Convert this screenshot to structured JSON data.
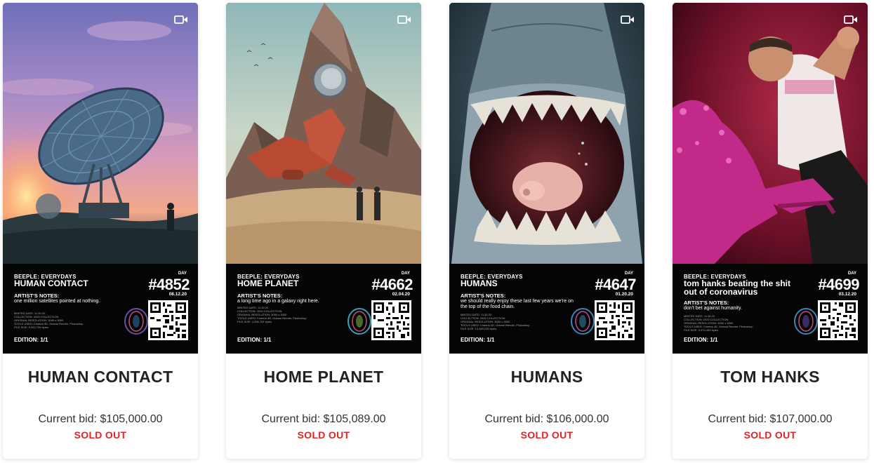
{
  "colors": {
    "sold_out": "#e02424",
    "card_bg": "#ffffff",
    "panel_bg": "#050505"
  },
  "icons": {
    "card_badge": "video-camera-icon"
  },
  "cards": [
    {
      "title": "HUMAN CONTACT",
      "bid_text": "Current bid: $105,000.00",
      "status": "SOLD OUT",
      "panel": {
        "series": "BEEPLE: EVERYDAYS",
        "art_title": "HUMAN CONTACT",
        "notes_heading": "ARTIST'S NOTES:",
        "notes": "one million satellites pointed at nothing.",
        "meta": "MINTED DATE: 11.30.20\nCOLLECTION: 2020 COLLECTION\nORIGINAL RESOLUTION: 3000 x 3000\nTOOLS USED: Cinema 4D, Octane Render, Photoshop\nFILE SIZE: 5,052,739 bytes",
        "day_label": "DAY",
        "day_number": "#4852",
        "date": "08.12.20",
        "edition": "EDITION: 1/1"
      }
    },
    {
      "title": "HOME PLANET",
      "bid_text": "Current bid: $105,089.00",
      "status": "SOLD OUT",
      "panel": {
        "series": "BEEPLE: EVERYDAYS",
        "art_title": "HOME PLANET",
        "notes_heading": "ARTIST'S NOTES:",
        "notes": "a long time ago in a galaxy right here.",
        "meta": "MINTED DATE: 11.30.20\nCOLLECTION: 2020 COLLECTION\nORIGINAL RESOLUTION: 3000 x 3000\nTOOLS USED: Cinema 4D, Octane Render, Photoshop\nFILE SIZE: 4,296,764 bytes",
        "day_label": "DAY",
        "day_number": "#4662",
        "date": "02.04.20",
        "edition": "EDITION: 1/1"
      }
    },
    {
      "title": "HUMANS",
      "bid_text": "Current bid: $106,000.00",
      "status": "SOLD OUT",
      "panel": {
        "series": "BEEPLE: EVERYDAYS",
        "art_title": "HUMANS",
        "notes_heading": "ARTIST'S NOTES:",
        "notes": "we should really enjoy these last few years we're on the top of the food chain.",
        "meta": "MINTED DATE: 11.30.20\nCOLLECTION: 2020 COLLECTION\nORIGINAL RESOLUTION: 3000 x 3000\nTOOLS USED: Cinema 4D, Octane Render, Photoshop\nFILE SIZE: 13,483,233 bytes",
        "day_label": "DAY",
        "day_number": "#4647",
        "date": "01.20.20",
        "edition": "EDITION: 1/1"
      }
    },
    {
      "title": "TOM HANKS",
      "bid_text": "Current bid: $107,000.00",
      "status": "SOLD OUT",
      "panel": {
        "series": "BEEPLE: EVERYDAYS",
        "art_title": "tom hanks beating the shit out of coronavirus",
        "notes_heading": "ARTIST'S NOTES:",
        "notes": "don't bet against humanity.",
        "meta": "MINTED DATE: 11.30.20\nCOLLECTION: 2020 COLLECTION\nORIGINAL RESOLUTION: 3000 x 3000\nTOOLS USED: Cinema 4D, Octane Render, Photoshop\nFILE SIZE: 3,474,459 bytes",
        "day_label": "DAY",
        "day_number": "#4699",
        "date": "03.12.20",
        "edition": "EDITION: 1/1"
      }
    }
  ]
}
